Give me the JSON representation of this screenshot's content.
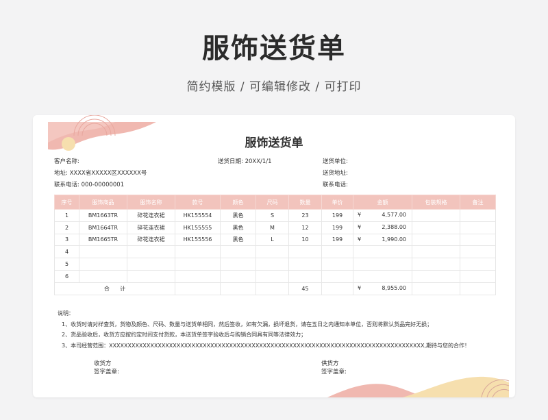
{
  "hero": {
    "title": "服饰送货单",
    "subtitle": "简约模版 /  可编辑修改  / 可打印"
  },
  "doc": {
    "title": "服饰送货单",
    "customer_label": "客户名称:",
    "delivery_date": "送货日期:  20XX/1/1",
    "address": "地址:  XXXX省XXXXX区XXXXXX号",
    "phone": "联系电话:  000-00000001",
    "sender_unit_label": "送货单位:",
    "sender_address_label": "送货地址:",
    "sender_phone_label": "联系电话:"
  },
  "table": {
    "headers": [
      "序号",
      "服饰商品",
      "服饰名称",
      "款号",
      "颜色",
      "尺码",
      "数量",
      "单价",
      "金额",
      "包装规格",
      "备注"
    ],
    "rows": [
      {
        "no": "1",
        "code": "BM1663TR",
        "name": "碎花连衣裙",
        "style": "HK155554",
        "color": "黑色",
        "size": "S",
        "qty": "23",
        "price": "199",
        "cur": "¥",
        "amount": "4,577.00"
      },
      {
        "no": "2",
        "code": "BM1664TR",
        "name": "碎花连衣裙",
        "style": "HK155555",
        "color": "黑色",
        "size": "M",
        "qty": "12",
        "price": "199",
        "cur": "¥",
        "amount": "2,388.00"
      },
      {
        "no": "3",
        "code": "BM1665TR",
        "name": "碎花连衣裙",
        "style": "HK155556",
        "color": "黑色",
        "size": "L",
        "qty": "10",
        "price": "199",
        "cur": "¥",
        "amount": "1,990.00"
      },
      {
        "no": "4",
        "code": "",
        "name": "",
        "style": "",
        "color": "",
        "size": "",
        "qty": "",
        "price": "",
        "cur": "",
        "amount": ""
      },
      {
        "no": "5",
        "code": "",
        "name": "",
        "style": "",
        "color": "",
        "size": "",
        "qty": "",
        "price": "",
        "cur": "",
        "amount": ""
      },
      {
        "no": "6",
        "code": "",
        "name": "",
        "style": "",
        "color": "",
        "size": "",
        "qty": "",
        "price": "",
        "cur": "",
        "amount": ""
      }
    ],
    "total": {
      "label": "合      计",
      "qty": "45",
      "cur": "¥",
      "amount": "8,955.00"
    }
  },
  "notes": {
    "heading": "说明：",
    "items": [
      "1、收货时请对样查货，货物及颜色、尺码、数量与送货单相同，然后签收，如有欠漏，损坏退货，请在五日之内通知本单位，否则将默认货品完好无损；",
      "2、货品验收后，收货方应按约定时间支付货款，本送货单签字验收后与购销合同具有同等法律效力；",
      "3、本司经营范围：XXXXXXXXXXXXXXXXXXXXXXXXXXXXXXXXXXXXXXXXXXXXXXXXXXXXXXXXXXXXXXXXXXXXXXXXXXXXXXXXXXXX,期待与您的合作！"
    ]
  },
  "signatures": {
    "receiver_title": "收货方",
    "receiver_sign": "签字盖章:",
    "supplier_title": "供货方",
    "supplier_sign": "签字盖章:"
  },
  "colors": {
    "header_pink": "#f2c4bd",
    "deco_pink": "#f0b8b0",
    "deco_cream": "#f6dfae"
  }
}
